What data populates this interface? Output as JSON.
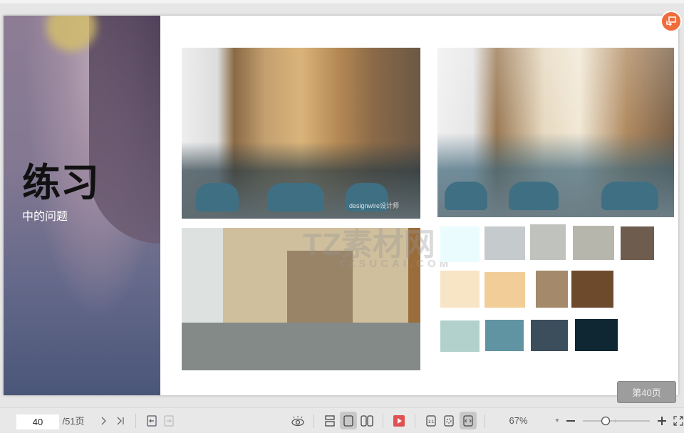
{
  "slide": {
    "title": "练习",
    "subtitle": "中的问题",
    "watermarks": [
      "TZ素材网",
      "TZSUCAI.COM",
      "designwire设计师"
    ],
    "palette_rows": [
      [
        "#eafcfd",
        "#c5cacc",
        "#c0c2bd",
        "#b6b6ac",
        "#6e5d4e"
      ],
      [
        "#f8e5c6",
        "#f2cd98",
        "#a48a6a",
        "#6e4a2c"
      ],
      [
        "#b2d1cc",
        "#6094a3",
        "#3c4e5c",
        "#0f2633"
      ]
    ]
  },
  "page_badge": "第40页",
  "toolbar": {
    "page_input": "40",
    "page_total": "/51页",
    "zoom": "67%"
  },
  "colors": {
    "accent": "#ef6d3b",
    "play": "#e05252"
  }
}
